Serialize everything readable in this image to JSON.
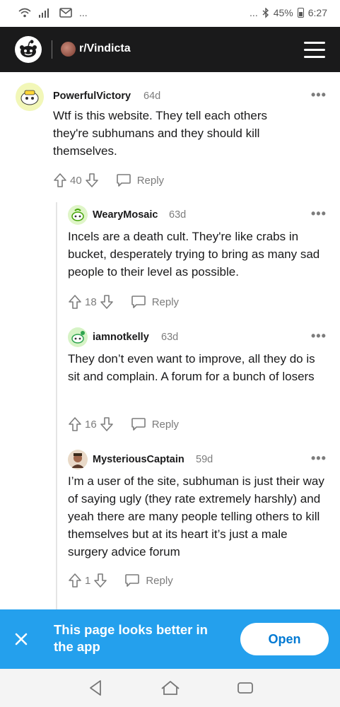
{
  "status_bar": {
    "dots": "...",
    "dots_right": "...",
    "battery": "45%",
    "time": "6:27"
  },
  "header": {
    "subreddit": "r/Vindicta"
  },
  "comments": [
    {
      "username": "PowerfulVictory",
      "age": "64d",
      "more": "•••",
      "text": "Wtf is this website. They tell each others they're subhumans and they should kill themselves.",
      "votes": "40",
      "reply": "Reply"
    },
    {
      "username": "WearyMosaic",
      "age": "63d",
      "more": "•••",
      "text": "Incels are a death cult. They're like crabs in bucket, desperately trying to bring as many sad people to their level as possible.",
      "votes": "18",
      "reply": "Reply"
    },
    {
      "username": "iamnotkelly",
      "age": "63d",
      "more": "•••",
      "text": "They don’t even want to improve, all they do is sit and complain. A forum for a bunch of losers",
      "votes": "16",
      "reply": "Reply"
    },
    {
      "username": "MysteriousCaptain",
      "age": "59d",
      "more": "•••",
      "text": "I’m a user of the site, subhuman is just their way of saying ugly (they rate extremely harshly) and yeah there are many people telling others to kill themselves but at its heart it’s just a male surgery advice forum",
      "votes": "1",
      "reply": "Reply"
    }
  ],
  "banner": {
    "text": "This page looks better in the app",
    "open": "Open",
    "color": "#24a0ed"
  },
  "colors": {
    "header_bg": "#1a1a1b",
    "muted": "#7c7c7c",
    "brand_blue": "#0079d3"
  }
}
